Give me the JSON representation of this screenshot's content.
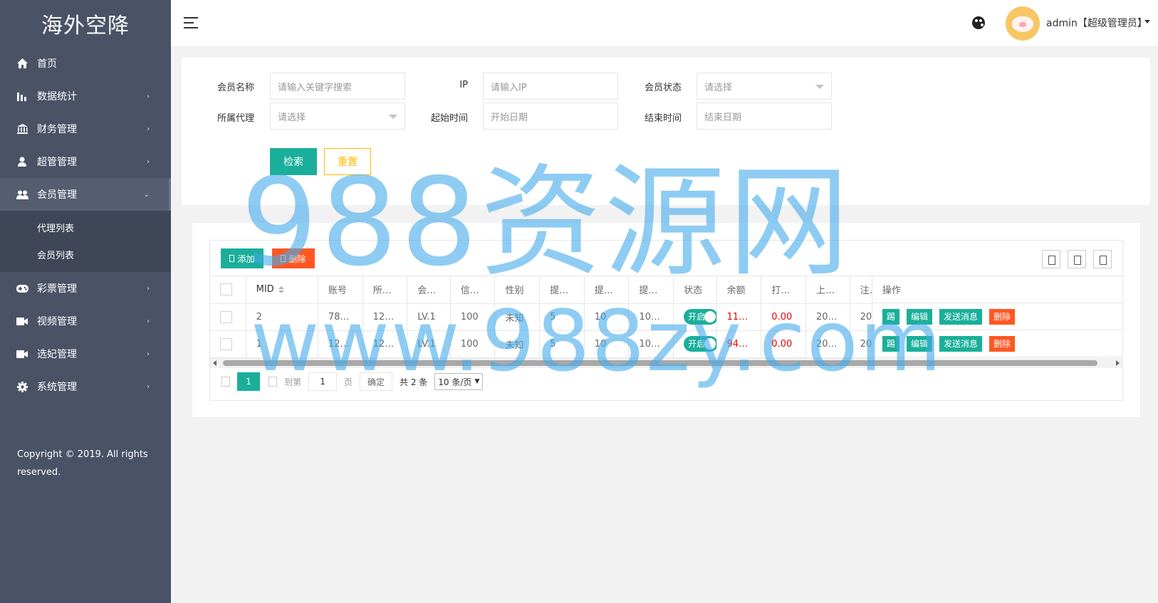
{
  "sidebar": {
    "logo": "海外空降",
    "items": [
      {
        "label": "首页",
        "icon": "home-icon",
        "chevron": ""
      },
      {
        "label": "数据统计",
        "icon": "bar-chart-icon",
        "chevron": "›"
      },
      {
        "label": "财务管理",
        "icon": "bank-icon",
        "chevron": "›"
      },
      {
        "label": "超管管理",
        "icon": "user-icon",
        "chevron": "›"
      },
      {
        "label": "会员管理",
        "icon": "users-icon",
        "chevron": "⌄"
      },
      {
        "label": "彩票管理",
        "icon": "gamepad-icon",
        "chevron": "›"
      },
      {
        "label": "视频管理",
        "icon": "video-icon",
        "chevron": "›"
      },
      {
        "label": "选妃管理",
        "icon": "camera-icon",
        "chevron": "›"
      },
      {
        "label": "系统管理",
        "icon": "gear-icon",
        "chevron": "›"
      }
    ],
    "sub_items": [
      "代理列表",
      "会员列表"
    ],
    "copyright": "Copyright © 2019. All rights reserved."
  },
  "header": {
    "user": "admin【超级管理员】"
  },
  "search": {
    "member_name_label": "会员名称",
    "member_name_placeholder": "请输入关键字搜索",
    "ip_label": "IP",
    "ip_placeholder": "请输入IP",
    "status_label": "会员状态",
    "status_placeholder": "请选择",
    "agent_label": "所属代理",
    "agent_placeholder": "请选择",
    "start_label": "起始时间",
    "start_placeholder": "开始日期",
    "end_label": "结束时间",
    "end_placeholder": "结束日期",
    "search_btn": "检索",
    "reset_btn": "重置"
  },
  "toolbar": {
    "add": "添加",
    "delete": "删除"
  },
  "table": {
    "columns": [
      "MID",
      "账号",
      "所…",
      "会…",
      "信…",
      "性别",
      "提…",
      "提…",
      "提…",
      "状态",
      "余额",
      "打…",
      "上…",
      "注…"
    ],
    "ops_header": "操作",
    "rows": [
      {
        "cells": [
          "2",
          "78…",
          "12…",
          "LV.1",
          "100",
          "未知",
          "5",
          "10",
          "10…",
          "开启",
          "11…",
          "0.00",
          "20…",
          "20…"
        ]
      },
      {
        "cells": [
          "1",
          "12…",
          "12…",
          "LV.1",
          "100",
          "未知",
          "5",
          "10",
          "10…",
          "开启",
          "94…",
          "0.00",
          "20…",
          "20…"
        ]
      }
    ],
    "ops": [
      "踢",
      "编辑",
      "发送消息",
      "删除"
    ]
  },
  "pager": {
    "current": "1",
    "goto_label": "到第",
    "goto_value": "1",
    "page_unit": "页",
    "confirm": "确定",
    "total": "共 2 条",
    "page_size": "10 条/页"
  },
  "watermark": {
    "line1": "988资源网",
    "line2": "www.988zy.com"
  }
}
